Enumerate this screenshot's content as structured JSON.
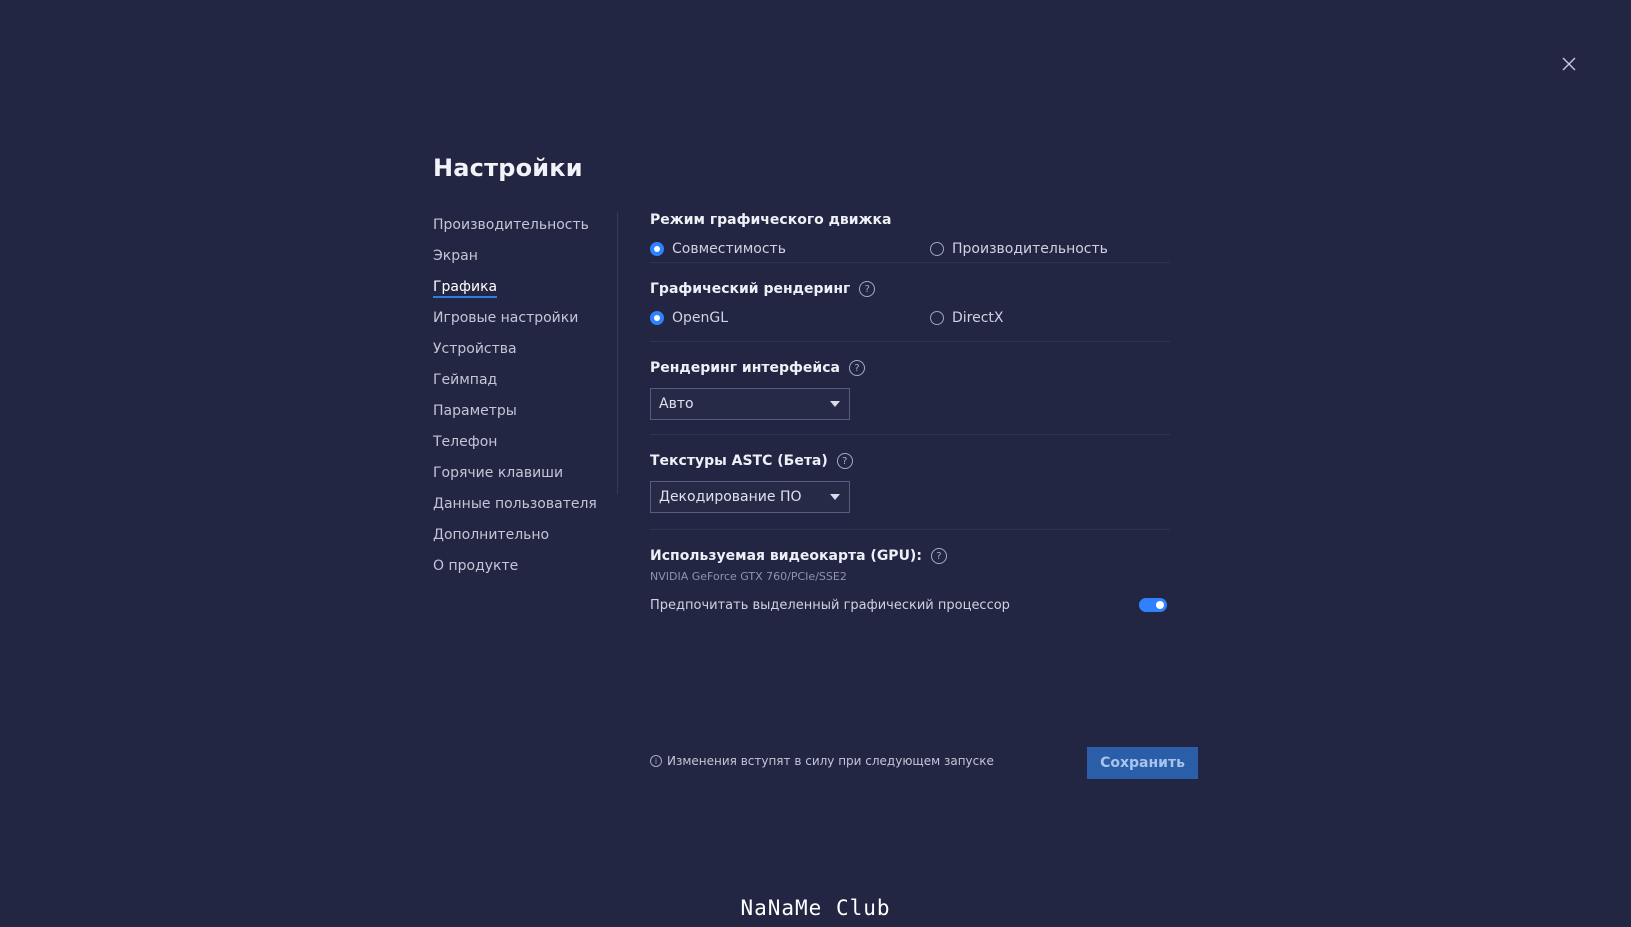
{
  "page_title": "Настройки",
  "sidebar": {
    "items": [
      {
        "label": "Производительность"
      },
      {
        "label": "Экран"
      },
      {
        "label": "Графика"
      },
      {
        "label": "Игровые настройки"
      },
      {
        "label": "Устройства"
      },
      {
        "label": "Геймпад"
      },
      {
        "label": "Параметры"
      },
      {
        "label": "Телефон"
      },
      {
        "label": "Горячие клавиши"
      },
      {
        "label": "Данные пользователя"
      },
      {
        "label": "Дополнительно"
      },
      {
        "label": "О продукте"
      }
    ],
    "active_item": "Графика"
  },
  "engine_mode": {
    "title": "Режим графического движка",
    "options": [
      "Совместимость",
      "Производительность"
    ],
    "selected": "Совместимость"
  },
  "graphics_rendering": {
    "title": "Графический рендеринг",
    "options": [
      "OpenGL",
      "DirectX"
    ],
    "selected": "OpenGL"
  },
  "interface_rendering": {
    "title": "Рендеринг интерфейса",
    "value": "Авто"
  },
  "astc_textures": {
    "title": "Текстуры ASTC (Бета)",
    "value": "Декодирование ПО"
  },
  "gpu": {
    "title": "Используемая видеокарта (GPU):",
    "name": "NVIDIA GeForce GTX 760/PCIe/SSE2",
    "prefer_dedicated_label": "Предпочитать выделенный графический процессор",
    "prefer_dedicated_enabled": true
  },
  "footer": {
    "notice": "Изменения вступят в силу при следующем запуске",
    "save_label": "Сохранить"
  },
  "watermark": "NaNaMe Club",
  "icons": {
    "close": "close-icon",
    "help": "help-icon",
    "info": "info-icon",
    "dropdown": "chevron-down-icon"
  },
  "colors": {
    "background": "#232642",
    "accent": "#2f82ff",
    "save_button": "#2a5ea9"
  }
}
